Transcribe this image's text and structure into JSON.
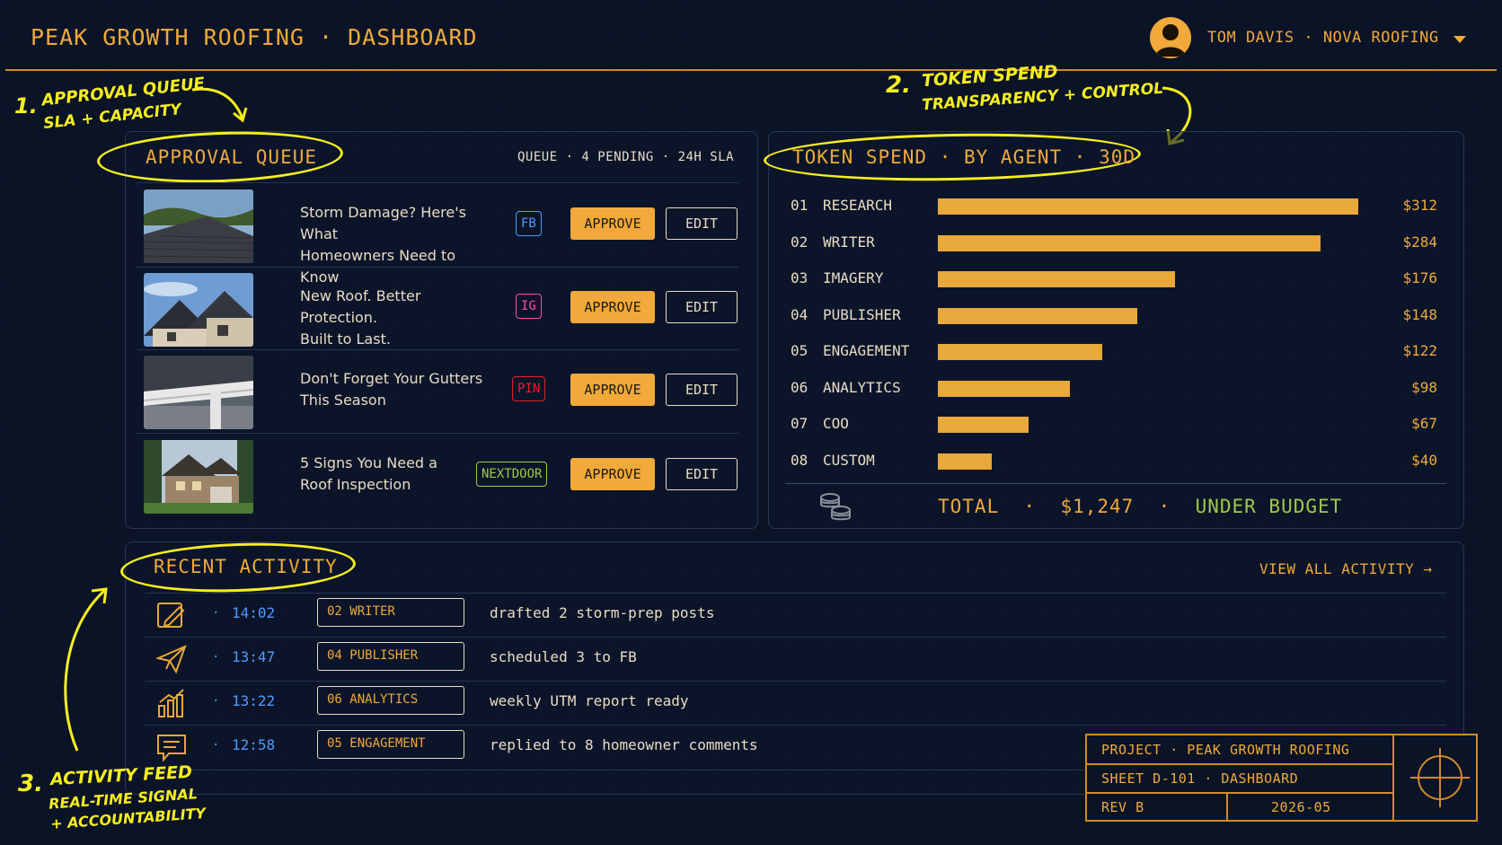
{
  "header": {
    "title": "PEAK GROWTH ROOFING · DASHBOARD",
    "user_text": "TOM DAVIS · NOVA ROOFING",
    "avatar_icon": "user-avatar-icon",
    "menu_icon": "chevron-down-icon"
  },
  "approval_queue": {
    "title": "APPROVAL QUEUE",
    "meta": "QUEUE · 4 PENDING · 24H SLA",
    "items": [
      {
        "line1": "Storm Damage? Here's What",
        "line2": "Homeowners Need to Know",
        "channel": "FB",
        "channel_color": "#4d9bff",
        "approve": "APPROVE",
        "edit": "EDIT",
        "image": "roof-shingles-photo"
      },
      {
        "line1": "New Roof. Better Protection.",
        "line2": "Built to Last.",
        "channel": "IG",
        "channel_color": "#ff4fa0",
        "approve": "APPROVE",
        "edit": "EDIT",
        "image": "house-roof-photo"
      },
      {
        "line1": "Don't Forget Your Gutters",
        "line2": "This Season",
        "channel": "PIN",
        "channel_color": "#e52222",
        "approve": "APPROVE",
        "edit": "EDIT",
        "image": "gutter-photo"
      },
      {
        "line1": "5 Signs You Need a",
        "line2": "Roof Inspection",
        "channel": "NEXTDOOR",
        "channel_color": "#9fc94a",
        "approve": "APPROVE",
        "edit": "EDIT",
        "image": "suburban-house-photo"
      }
    ]
  },
  "token_spend": {
    "title": "TOKEN SPEND · BY AGENT · 30D",
    "rows": [
      {
        "idx": "01",
        "name": "RESEARCH",
        "value": "$312",
        "amount": 312
      },
      {
        "idx": "02",
        "name": "WRITER",
        "value": "$284",
        "amount": 284
      },
      {
        "idx": "03",
        "name": "IMAGERY",
        "value": "$176",
        "amount": 176
      },
      {
        "idx": "04",
        "name": "PUBLISHER",
        "value": "$148",
        "amount": 148
      },
      {
        "idx": "05",
        "name": "ENGAGEMENT",
        "value": "$122",
        "amount": 122
      },
      {
        "idx": "06",
        "name": "ANALYTICS",
        "value": "$98",
        "amount": 98
      },
      {
        "idx": "07",
        "name": "COO",
        "value": "$67",
        "amount": 67
      },
      {
        "idx": "08",
        "name": "CUSTOM",
        "value": "$40",
        "amount": 40
      }
    ],
    "total_label": "TOTAL",
    "total_value": "$1,247",
    "status": "UNDER BUDGET",
    "coins_icon": "coins-icon"
  },
  "recent_activity": {
    "title": "RECENT ACTIVITY",
    "view_all": "VIEW ALL ACTIVITY →",
    "items": [
      {
        "icon": "pencil-icon",
        "dot": "·",
        "time": "14:02",
        "agent": "02  WRITER",
        "text": "drafted 2 storm-prep posts"
      },
      {
        "icon": "paper-plane-icon",
        "dot": "·",
        "time": "13:47",
        "agent": "04  PUBLISHER",
        "text": "scheduled 3 to FB"
      },
      {
        "icon": "bar-chart-icon",
        "dot": "·",
        "time": "13:22",
        "agent": "06  ANALYTICS",
        "text": "weekly UTM report ready"
      },
      {
        "icon": "chat-bubble-icon",
        "dot": "·",
        "time": "12:58",
        "agent": "05  ENGAGEMENT",
        "text": "replied to 8 homeowner comments"
      }
    ]
  },
  "annotations": {
    "a1_num": "1.",
    "a1_line1": "APPROVAL QUEUE",
    "a1_line2": "SLA + CAPACITY",
    "a2_num": "2.",
    "a2_line1": "TOKEN SPEND",
    "a2_line2": "TRANSPARENCY + CONTROL",
    "a3_num": "3.",
    "a3_line1": "ACTIVITY FEED",
    "a3_line2": "REAL-TIME SIGNAL",
    "a3_line3": "+ ACCOUNTABILITY"
  },
  "title_block": {
    "project": "PROJECT · PEAK GROWTH ROOFING",
    "sheet": "SHEET D-101 · DASHBOARD",
    "rev": "REV B",
    "date": "2026-05",
    "crosshair_icon": "crosshair-icon"
  }
}
